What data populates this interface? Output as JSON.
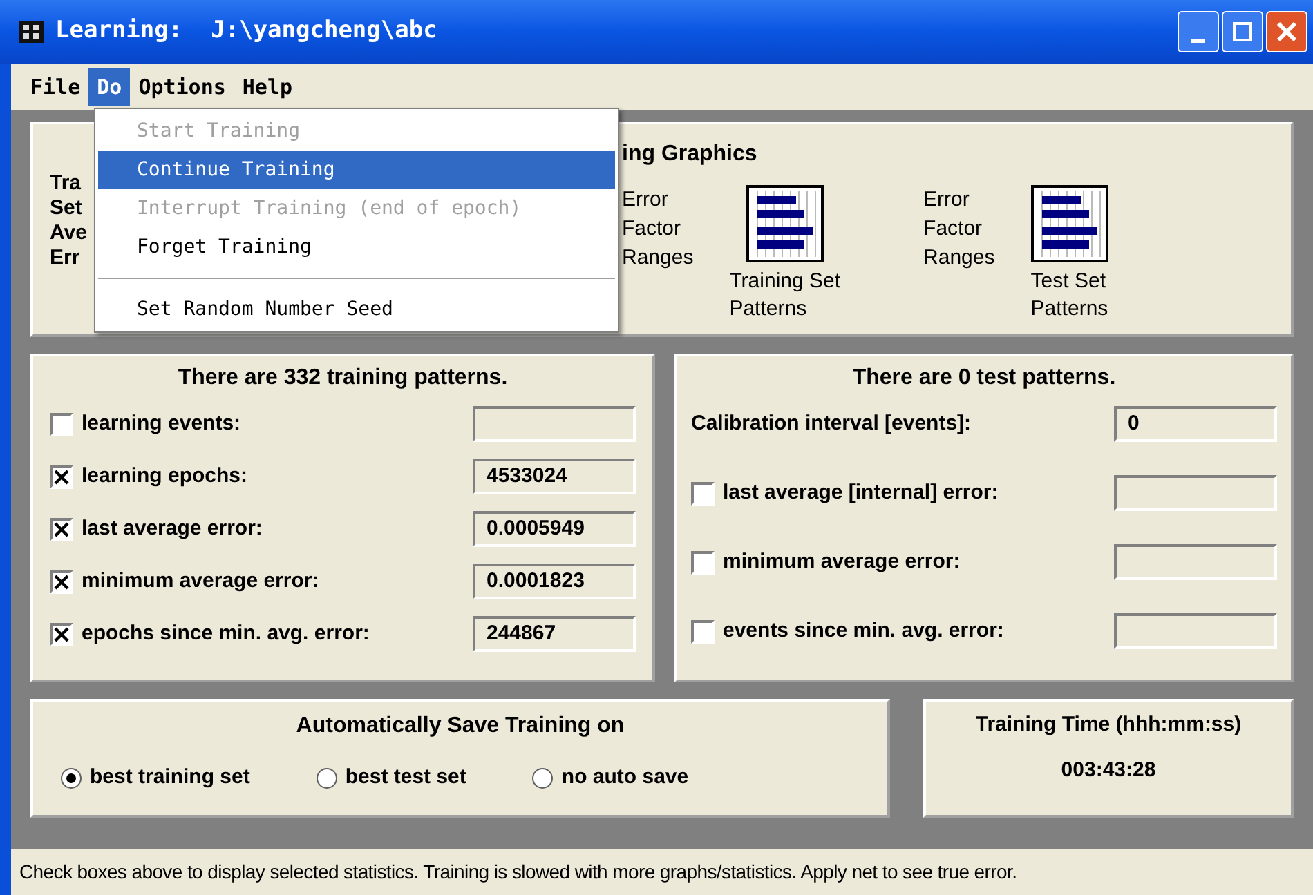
{
  "window": {
    "title": "Learning:  J:\\yangcheng\\abc"
  },
  "menu": [
    {
      "label": "File",
      "selected": false
    },
    {
      "label": "Do",
      "selected": true
    },
    {
      "label": "Options",
      "selected": false
    },
    {
      "label": "Help",
      "selected": false
    }
  ],
  "dropdown": [
    {
      "kind": "item",
      "label": "Start Training",
      "disabled": true,
      "selected": false
    },
    {
      "kind": "item",
      "label": "Continue Training",
      "disabled": false,
      "selected": true
    },
    {
      "kind": "item",
      "label": "Interrupt Training (end of epoch)",
      "disabled": true,
      "selected": false
    },
    {
      "kind": "item",
      "label": "Forget Training",
      "disabled": false,
      "selected": false
    },
    {
      "kind": "separator"
    },
    {
      "kind": "item",
      "label": "Set Random Number Seed",
      "disabled": false,
      "selected": false
    }
  ],
  "top_panel": {
    "labels": [
      "Tra",
      "Set",
      "Ave",
      "Err"
    ],
    "graphics_title": "ing Graphics",
    "graphics": [
      {
        "lines": [
          "Error",
          "Factor",
          "Ranges"
        ],
        "caption": [
          "Training Set",
          "Patterns"
        ]
      },
      {
        "lines": [
          "Error",
          "Factor",
          "Ranges"
        ],
        "caption": [
          "Test Set",
          "Patterns"
        ]
      }
    ]
  },
  "training_panel": {
    "title": "There are 332 training patterns.",
    "rows": [
      {
        "kind": "check",
        "label": "learning events:",
        "checked": false,
        "value": ""
      },
      {
        "kind": "check",
        "label": "learning epochs:",
        "checked": true,
        "value": "4533024"
      },
      {
        "kind": "check",
        "label": "last average error:",
        "checked": true,
        "value": "0.0005949"
      },
      {
        "kind": "check",
        "label": "minimum average error:",
        "checked": true,
        "value": "0.0001823"
      },
      {
        "kind": "check",
        "label": "epochs since min. avg. error:",
        "checked": true,
        "value": "244867"
      }
    ]
  },
  "test_panel": {
    "title": "There are 0 test patterns.",
    "rows": [
      {
        "kind": "field",
        "label": "Calibration interval [events]:",
        "value": "0"
      },
      {
        "kind": "check",
        "label": "last average [internal] error:",
        "checked": false,
        "value": ""
      },
      {
        "kind": "check",
        "label": "minimum average error:",
        "checked": false,
        "value": ""
      },
      {
        "kind": "check",
        "label": "events since min. avg. error:",
        "checked": false,
        "value": ""
      }
    ]
  },
  "autosave": {
    "title": "Automatically Save Training on",
    "options": [
      {
        "label": "best training set",
        "selected": true
      },
      {
        "label": "best test set",
        "selected": false
      },
      {
        "label": "no auto save",
        "selected": false
      }
    ]
  },
  "training_time": {
    "title": "Training Time (hhh:mm:ss)",
    "value": "003:43:28"
  },
  "status_bar": "Check boxes above to display selected statistics. Training is slowed with more graphs/statistics. Apply net to see true error."
}
